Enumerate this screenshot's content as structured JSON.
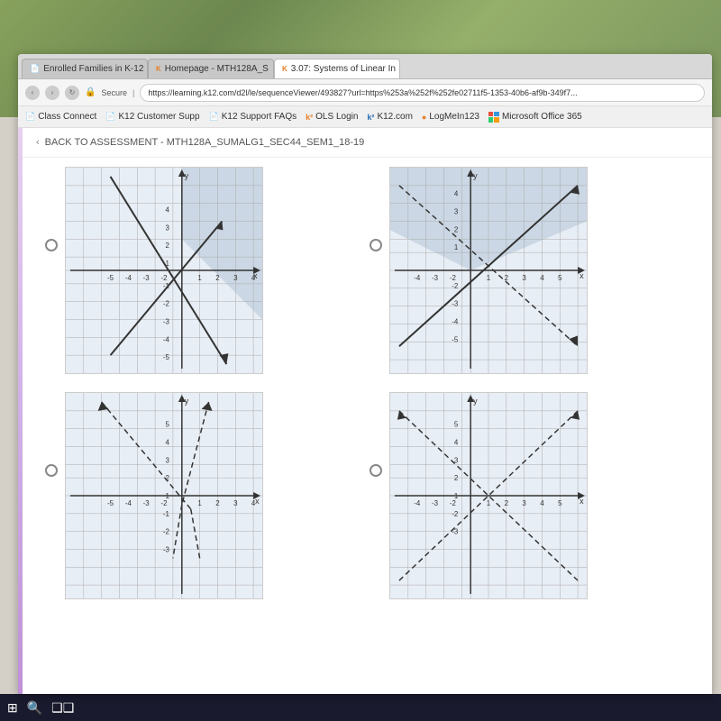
{
  "background": {
    "color": "#7a9a4a"
  },
  "browser": {
    "tabs": [
      {
        "id": "tab1",
        "label": "Enrolled Families in K-12",
        "active": false,
        "icon": "page"
      },
      {
        "id": "tab2",
        "label": "Homepage - MTH128A_S",
        "active": false,
        "icon": "k12-orange"
      },
      {
        "id": "tab3",
        "label": "3.07: Systems of Linear In",
        "active": true,
        "icon": "k12-orange"
      }
    ],
    "address": "https://learning.k12.com/d2l/le/sequenceViewer/493827?url=https%253a%252f%252fe02711f5-1353-40b6-af9b-349f7...",
    "bookmarks": [
      {
        "label": "Class Connect",
        "icon": "page"
      },
      {
        "label": "K12 Customer Supp",
        "icon": "page"
      },
      {
        "label": "K12 Support FAQs",
        "icon": "page"
      },
      {
        "label": "OLS Login",
        "icon": "k12-bold"
      },
      {
        "label": "K12.com",
        "icon": "k12-bold"
      },
      {
        "label": "LogMeIn123",
        "icon": "circle"
      },
      {
        "label": "Microsoft Office 365",
        "icon": "office-grid"
      }
    ]
  },
  "page": {
    "back_label": "BACK TO ASSESSMENT - MTH128A_SUMALG1_SEC44_SEM1_18-19",
    "graphs": [
      {
        "id": "graph1",
        "selected": false,
        "description": "Two lines forming an X shape, one solid going from top-left down steeply, one solid going from bottom-left up, intersecting near origin-right area. Shaded region top-right."
      },
      {
        "id": "graph2",
        "selected": false,
        "description": "Two lines, one dashed going from upper-left to lower-right, one solid going from lower-left to upper-right, intersecting. Shaded region top."
      },
      {
        "id": "graph3",
        "selected": false,
        "description": "Two dashed lines forming a V shape pointing upward, both starting from upper area. Shaded region."
      },
      {
        "id": "graph4",
        "selected": false,
        "description": "Two dashed lines forming an X, one from upper-left going down-right, one from lower-left going up-right. No shading visible."
      }
    ]
  }
}
